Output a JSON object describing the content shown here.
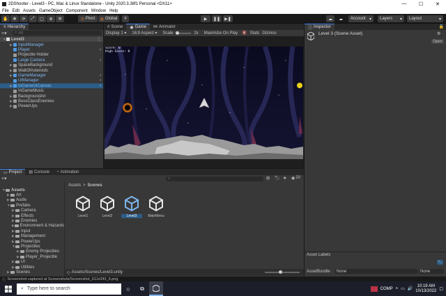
{
  "window": {
    "title": "2DShooter - Level3 - PC, Mac & Linux Standalone - Unity 2020.3.38f1 Personal <DX11>",
    "minimize": "—",
    "maximize": "☐",
    "close": "✕"
  },
  "menu": [
    "File",
    "Edit",
    "Assets",
    "GameObject",
    "Component",
    "Window",
    "Help"
  ],
  "toolbar": {
    "pivot": "Pivot",
    "global": "Global",
    "account": "Account",
    "layers": "Layers",
    "layout": "Layout"
  },
  "hierarchy": {
    "tab": "Hierarchy",
    "search_placeholder": "All",
    "scene": "Level3",
    "items": [
      {
        "label": "InputManager",
        "prefab": true
      },
      {
        "label": "Player",
        "prefab": true
      },
      {
        "label": "Projectile Holder",
        "prefab": false
      },
      {
        "label": "Large Camera",
        "prefab": true
      },
      {
        "label": "SpaceBackground",
        "prefab": false
      },
      {
        "label": "WallOfAsteroids",
        "prefab": false
      },
      {
        "label": "GameManager",
        "prefab": true
      },
      {
        "label": "UIManager",
        "prefab": true
      },
      {
        "label": "InGameUICanvas",
        "prefab": true
      },
      {
        "label": "InGameMusic",
        "prefab": false
      },
      {
        "label": "BackgroundArt",
        "prefab": false
      },
      {
        "label": "BossClassEnemies",
        "prefab": false
      },
      {
        "label": "PowerUps",
        "prefab": false
      }
    ]
  },
  "center_tabs": {
    "scene": "Scene",
    "game": "Game",
    "animator": "Animator"
  },
  "game_toolbar": {
    "display": "Display 1",
    "aspect": "16:9 Aspect",
    "scale_label": "Scale",
    "scale_value": "2x",
    "maximize": "Maximize On Play",
    "stats": "Stats",
    "gizmos": "Gizmos"
  },
  "game_hud": {
    "score": "Score: 0",
    "high_score": "High Score: 0"
  },
  "inspector": {
    "tab": "Inspector",
    "asset_title": "Level 3 (Scene Asset)",
    "open_button": "Open",
    "asset_labels": "Asset Labels",
    "assetbundle_label": "AssetBundle",
    "assetbundle_value": "None",
    "variant_value": "None"
  },
  "bottom_tabs": {
    "project": "Project",
    "console": "Console",
    "animation": "Animation"
  },
  "project": {
    "count": "20",
    "breadcrumb_root": "Assets",
    "breadcrumb_sep": ">",
    "breadcrumb_current": "Scenes",
    "tree": [
      {
        "label": "Assets",
        "level": 0,
        "expanded": true
      },
      {
        "label": "Art",
        "level": 1,
        "expanded": false
      },
      {
        "label": "Audio",
        "level": 1,
        "expanded": false
      },
      {
        "label": "Prefabs",
        "level": 1,
        "expanded": true
      },
      {
        "label": "Camera",
        "level": 2,
        "expanded": false
      },
      {
        "label": "Effects",
        "level": 2,
        "expanded": false
      },
      {
        "label": "Enemies",
        "level": 2,
        "expanded": false
      },
      {
        "label": "Environment & Hazards",
        "level": 2,
        "expanded": false
      },
      {
        "label": "Input",
        "level": 2,
        "expanded": false
      },
      {
        "label": "Management",
        "level": 2,
        "expanded": false
      },
      {
        "label": "PowerUps",
        "level": 2,
        "expanded": false
      },
      {
        "label": "Projectiles",
        "level": 2,
        "expanded": true
      },
      {
        "label": "Enemy Projectiles",
        "level": 3,
        "expanded": false
      },
      {
        "label": "Player_Projectile",
        "level": 3,
        "expanded": false
      },
      {
        "label": "UI",
        "level": 2,
        "expanded": false
      },
      {
        "label": "Utilities",
        "level": 2,
        "expanded": false
      },
      {
        "label": "Scenes",
        "level": 1,
        "expanded": false
      }
    ],
    "assets": [
      "Level1",
      "Level2",
      "Level3",
      "MainMenu"
    ],
    "path": "Assets/Scenes/Level3.unity"
  },
  "status": "Screenshot captured at Screenshots/Screenshot_611x343_6.png",
  "taskbar": {
    "search_placeholder": "Type here to search",
    "comp": "COMP",
    "time": "10:19 AM",
    "date": "10/13/2022"
  },
  "colors": {
    "accent": "#4c8bf5",
    "selection": "#2c5d87",
    "prefab_text": "#7fb6ee"
  }
}
